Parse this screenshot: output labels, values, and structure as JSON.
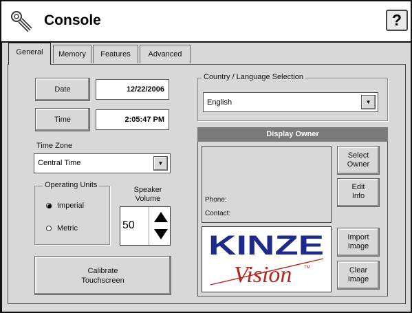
{
  "app": {
    "title": "Console",
    "help_label": "?"
  },
  "tabs": [
    {
      "label": "General",
      "active": true
    },
    {
      "label": "Memory",
      "active": false
    },
    {
      "label": "Features",
      "active": false
    },
    {
      "label": "Advanced",
      "active": false
    }
  ],
  "date": {
    "button_label": "Date",
    "value": "12/22/2006"
  },
  "time": {
    "button_label": "Time",
    "value": "2:05:47 PM"
  },
  "timezone": {
    "label": "Time Zone",
    "selected": "Central Time"
  },
  "units": {
    "legend": "Operating Units",
    "options": [
      {
        "label": "Imperial",
        "selected": true
      },
      {
        "label": "Metric",
        "selected": false
      }
    ]
  },
  "speaker": {
    "label_line1": "Speaker",
    "label_line2": "Volume",
    "value": "50"
  },
  "calibrate": {
    "line1": "Calibrate",
    "line2": "Touchscreen"
  },
  "country": {
    "legend": "Country / Language Selection",
    "selected": "English"
  },
  "owner": {
    "header": "Display Owner",
    "phone_label": "Phone:",
    "contact_label": "Contact:",
    "select_line1": "Select",
    "select_line2": "Owner",
    "edit_line1": "Edit",
    "edit_line2": "Info",
    "import_line1": "Import",
    "import_line2": "Image",
    "clear_line1": "Clear",
    "clear_line2": "Image"
  },
  "logo": {
    "brand_top": "KINZE",
    "brand_bottom": "Vision",
    "tm": "TM"
  },
  "colors": {
    "logo_blue": "#1c2a8c",
    "logo_red": "#b8241e",
    "owner_header_bg": "#7a7a7a"
  }
}
